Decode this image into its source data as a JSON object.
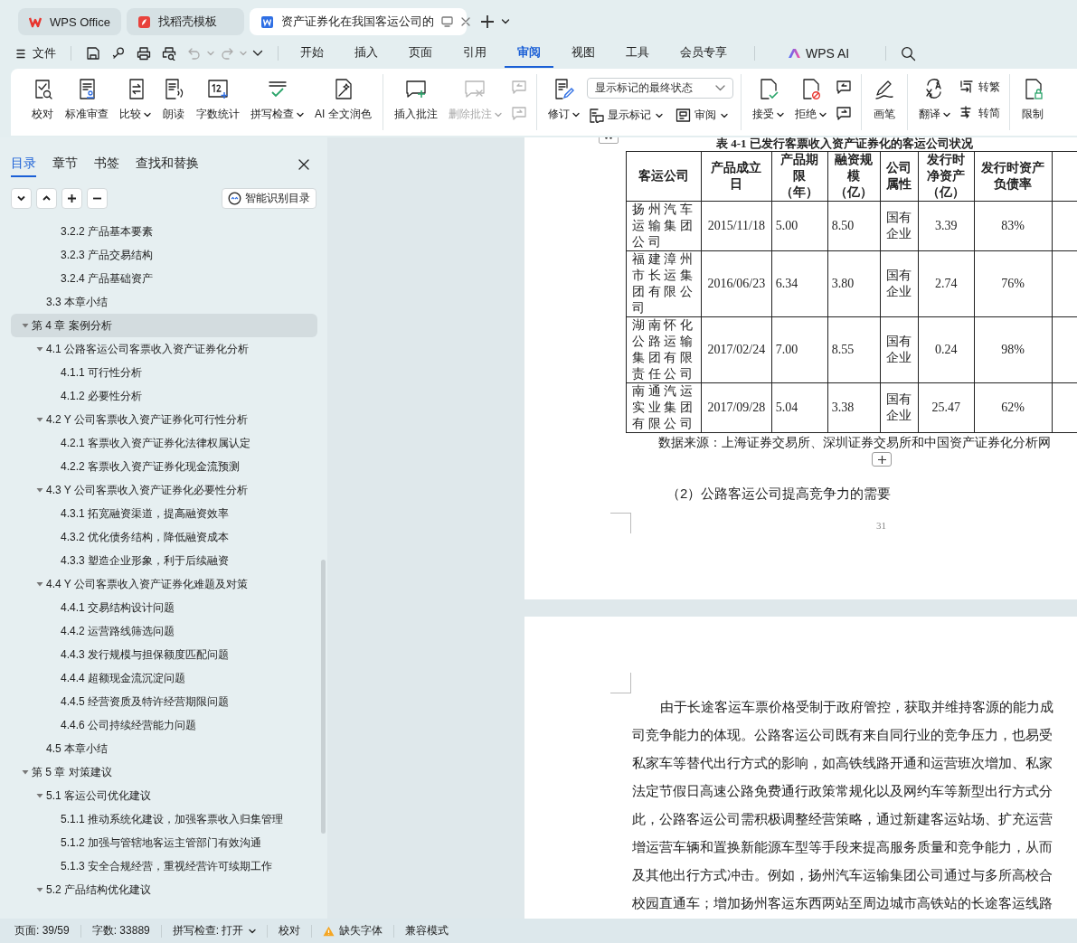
{
  "tabs": [
    {
      "label": "WPS Office",
      "selected": false
    },
    {
      "label": "找稻壳模板",
      "selected": false
    },
    {
      "label": "资产证券化在我国客运公司的",
      "selected": true
    }
  ],
  "menu": {
    "file": "文件",
    "tabs": [
      {
        "label": "开始",
        "selected": false
      },
      {
        "label": "插入",
        "selected": false
      },
      {
        "label": "页面",
        "selected": false
      },
      {
        "label": "引用",
        "selected": false
      },
      {
        "label": "审阅",
        "selected": true
      },
      {
        "label": "视图",
        "selected": false
      },
      {
        "label": "工具",
        "selected": false
      },
      {
        "label": "会员专享",
        "selected": false
      }
    ],
    "ai": "WPS AI"
  },
  "ribbon": [
    {
      "items": [
        {
          "kind": "large",
          "label": "校对",
          "dropdown": false,
          "disabled": false
        },
        {
          "kind": "large",
          "label": "标准审查",
          "dropdown": false,
          "disabled": false
        },
        {
          "kind": "large",
          "label": "比较",
          "dropdown": true,
          "disabled": false
        },
        {
          "kind": "large",
          "label": "朗读",
          "dropdown": false,
          "disabled": false
        },
        {
          "kind": "large",
          "label": "字数统计",
          "dropdown": false,
          "disabled": false
        },
        {
          "kind": "large",
          "label": "拼写检查",
          "dropdown": true,
          "disabled": false
        },
        {
          "kind": "large",
          "label": "AI 全文润色",
          "dropdown": false,
          "disabled": false
        }
      ]
    },
    {
      "items": [
        {
          "kind": "large",
          "label": "插入批注",
          "dropdown": false,
          "disabled": false
        },
        {
          "kind": "large",
          "label": "删除批注",
          "dropdown": true,
          "disabled": true
        },
        {
          "kind": "stack",
          "rows": [
            [
              {
                "kind": "icon",
                "disabled": true
              }
            ],
            [
              {
                "kind": "icon",
                "disabled": true
              }
            ]
          ]
        }
      ]
    },
    {
      "items": [
        {
          "kind": "large",
          "label": "修订",
          "dropdown": true,
          "disabled": false
        },
        {
          "kind": "stack",
          "rows": [
            [
              {
                "kind": "select",
                "value": "显示标记的最终状态"
              }
            ],
            [
              {
                "kind": "small",
                "label": "显示标记",
                "dropdown": true,
                "disabled": false
              },
              {
                "kind": "small",
                "label": "审阅",
                "dropdown": true,
                "disabled": false
              }
            ]
          ]
        }
      ]
    },
    {
      "items": [
        {
          "kind": "large",
          "label": "接受",
          "dropdown": true,
          "disabled": false
        },
        {
          "kind": "large",
          "label": "拒绝",
          "dropdown": true,
          "disabled": false
        },
        {
          "kind": "stack",
          "rows": [
            [
              {
                "kind": "icon",
                "disabled": false
              }
            ],
            [
              {
                "kind": "icon",
                "disabled": false
              }
            ]
          ]
        }
      ]
    },
    {
      "items": [
        {
          "kind": "large",
          "label": "画笔",
          "dropdown": false,
          "disabled": false
        }
      ]
    },
    {
      "items": [
        {
          "kind": "large",
          "label": "翻译",
          "dropdown": true,
          "disabled": false
        },
        {
          "kind": "stack",
          "rows": [
            [
              {
                "kind": "small",
                "label": "转繁",
                "dropdown": false,
                "disabled": false
              }
            ],
            [
              {
                "kind": "small",
                "label": "转简",
                "dropdown": false,
                "disabled": false
              }
            ]
          ]
        }
      ]
    },
    {
      "items": [
        {
          "kind": "large",
          "label": "限制",
          "dropdown": false,
          "disabled": false
        }
      ]
    }
  ],
  "sidebar": {
    "tabs": [
      {
        "label": "目录",
        "selected": true
      },
      {
        "label": "章节",
        "selected": false
      },
      {
        "label": "书签",
        "selected": false
      },
      {
        "label": "查找和替换",
        "selected": false
      }
    ],
    "smart_button": "智能识别目录",
    "toc": [
      {
        "children": [
          {
            "children": [
              {
                "label": "3.2.2 产品基本要素",
                "selected": false
              },
              {
                "label": "3.2.3 产品交易结构",
                "selected": false
              },
              {
                "label": "3.2.4 产品基础资产",
                "selected": false
              }
            ]
          },
          {
            "label": "3.3  本章小结",
            "selected": false
          }
        ]
      },
      {
        "label": "第 4 章  案例分析",
        "selected": true,
        "expanded": true,
        "children": [
          {
            "label": "4.1 公路客运公司客票收入资产证券化分析",
            "selected": false,
            "expanded": true,
            "children": [
              {
                "label": "4.1.1 可行性分析",
                "selected": false
              },
              {
                "label": "4.1.2 必要性分析",
                "selected": false
              }
            ]
          },
          {
            "label": "4.2 Y 公司客票收入资产证券化可行性分析",
            "selected": false,
            "expanded": true,
            "children": [
              {
                "label": "4.2.1 客票收入资产证券化法律权属认定",
                "selected": false
              },
              {
                "label": "4.2.2 客票收入资产证券化现金流预测",
                "selected": false
              }
            ]
          },
          {
            "label": "4.3 Y 公司客票收入资产证券化必要性分析",
            "selected": false,
            "expanded": true,
            "children": [
              {
                "label": "4.3.1 拓宽融资渠道，提高融资效率",
                "selected": false
              },
              {
                "label": "4.3.2 优化债务结构，降低融资成本",
                "selected": false
              },
              {
                "label": "4.3.3 塑造企业形象，利于后续融资",
                "selected": false
              }
            ]
          },
          {
            "label": "4.4 Y 公司客票收入资产证券化难题及对策",
            "selected": false,
            "expanded": true,
            "children": [
              {
                "label": "4.4.1 交易结构设计问题",
                "selected": false
              },
              {
                "label": "4.4.2 运营路线筛选问题",
                "selected": false
              },
              {
                "label": "4.4.3 发行规模与担保额度匹配问题",
                "selected": false
              },
              {
                "label": "4.4.4 超额现金流沉淀问题",
                "selected": false
              },
              {
                "label": "4.4.5 经营资质及特许经营期限问题",
                "selected": false
              },
              {
                "label": "4.4.6 公司持续经营能力问题",
                "selected": false
              }
            ]
          },
          {
            "label": "4.5 本章小结",
            "selected": false
          }
        ]
      },
      {
        "label": "第 5 章  对策建议",
        "selected": false,
        "expanded": true,
        "children": [
          {
            "label": "5.1  客运公司优化建议",
            "selected": false,
            "expanded": true,
            "children": [
              {
                "label": "5.1.1 推动系统化建设，加强客票收入归集管理",
                "selected": false
              },
              {
                "label": "5.1.2 加强与管辖地客运主管部门有效沟通",
                "selected": false
              },
              {
                "label": "5.1.3 安全合规经营，重视经营许可续期工作",
                "selected": false
              }
            ]
          },
          {
            "label": "5.2  产品结构优化建议",
            "selected": false,
            "expanded": true
          }
        ]
      }
    ]
  },
  "document": {
    "caption": "表 4-1  已发行客票收入资产证券化的客运公司状况",
    "table": {
      "columns": [
        "客运公司",
        "产品成立日",
        "产品期限（年）",
        "融资规模（亿）",
        "公司属性",
        "发行时净资产（亿）",
        "发行时资产负债率"
      ],
      "rows": [
        [
          "扬州汽车运输集团公司",
          "2015/11/18",
          "5.00",
          "8.50",
          "国有企业",
          "3.39",
          "83%"
        ],
        [
          "福建漳州市长运集团有限公司",
          "2016/06/23",
          "6.34",
          "3.80",
          "国有企业",
          "2.74",
          "76%"
        ],
        [
          "湖南怀化公路运输集团有限责任公司",
          "2017/02/24",
          "7.00",
          "8.55",
          "国有企业",
          "0.24",
          "98%"
        ],
        [
          "南通汽运实业集团有限公司",
          "2017/09/28",
          "5.04",
          "3.38",
          "国有企业",
          "25.47",
          "62%"
        ]
      ]
    },
    "source": "数据来源：上海证券交易所、深圳证券交易所和中国资产证券化分析网",
    "heading": "（2）公路客运公司提高竞争力的需要",
    "page_number": "31",
    "paragraph_lines": [
      "由于长途客运车票价格受制于政府管控，获取并维持客源的能力成",
      "司竞争能力的体现。公路客运公司既有来自同行业的竞争压力，也易受",
      "私家车等替代出行方式的影响，如高铁线路开通和运营班次增加、私家",
      "法定节假日高速公路免费通行政策常规化以及网约车等新型出行方式分",
      "此，公路客运公司需积极调整经营策略，通过新建客运站场、扩充运营",
      "增运营车辆和置换新能源车型等手段来提高服务质量和竞争能力，从而",
      "及其他出行方式冲击。例如，扬州汽车运输集团公司通过与多所高校合",
      "校园直通车；增加扬州客运东西两站至周边城市高铁站的长途客运线路"
    ]
  },
  "status_bar": [
    {
      "kind": "text",
      "text": "页面: 39/59"
    },
    {
      "kind": "text",
      "text": "字数: 33889"
    },
    {
      "kind": "dropdown",
      "text": "拼写检查: 打开"
    },
    {
      "kind": "text",
      "text": "校对"
    },
    {
      "kind": "warning",
      "text": "缺失字体"
    },
    {
      "kind": "text",
      "text": "兼容模式"
    }
  ]
}
